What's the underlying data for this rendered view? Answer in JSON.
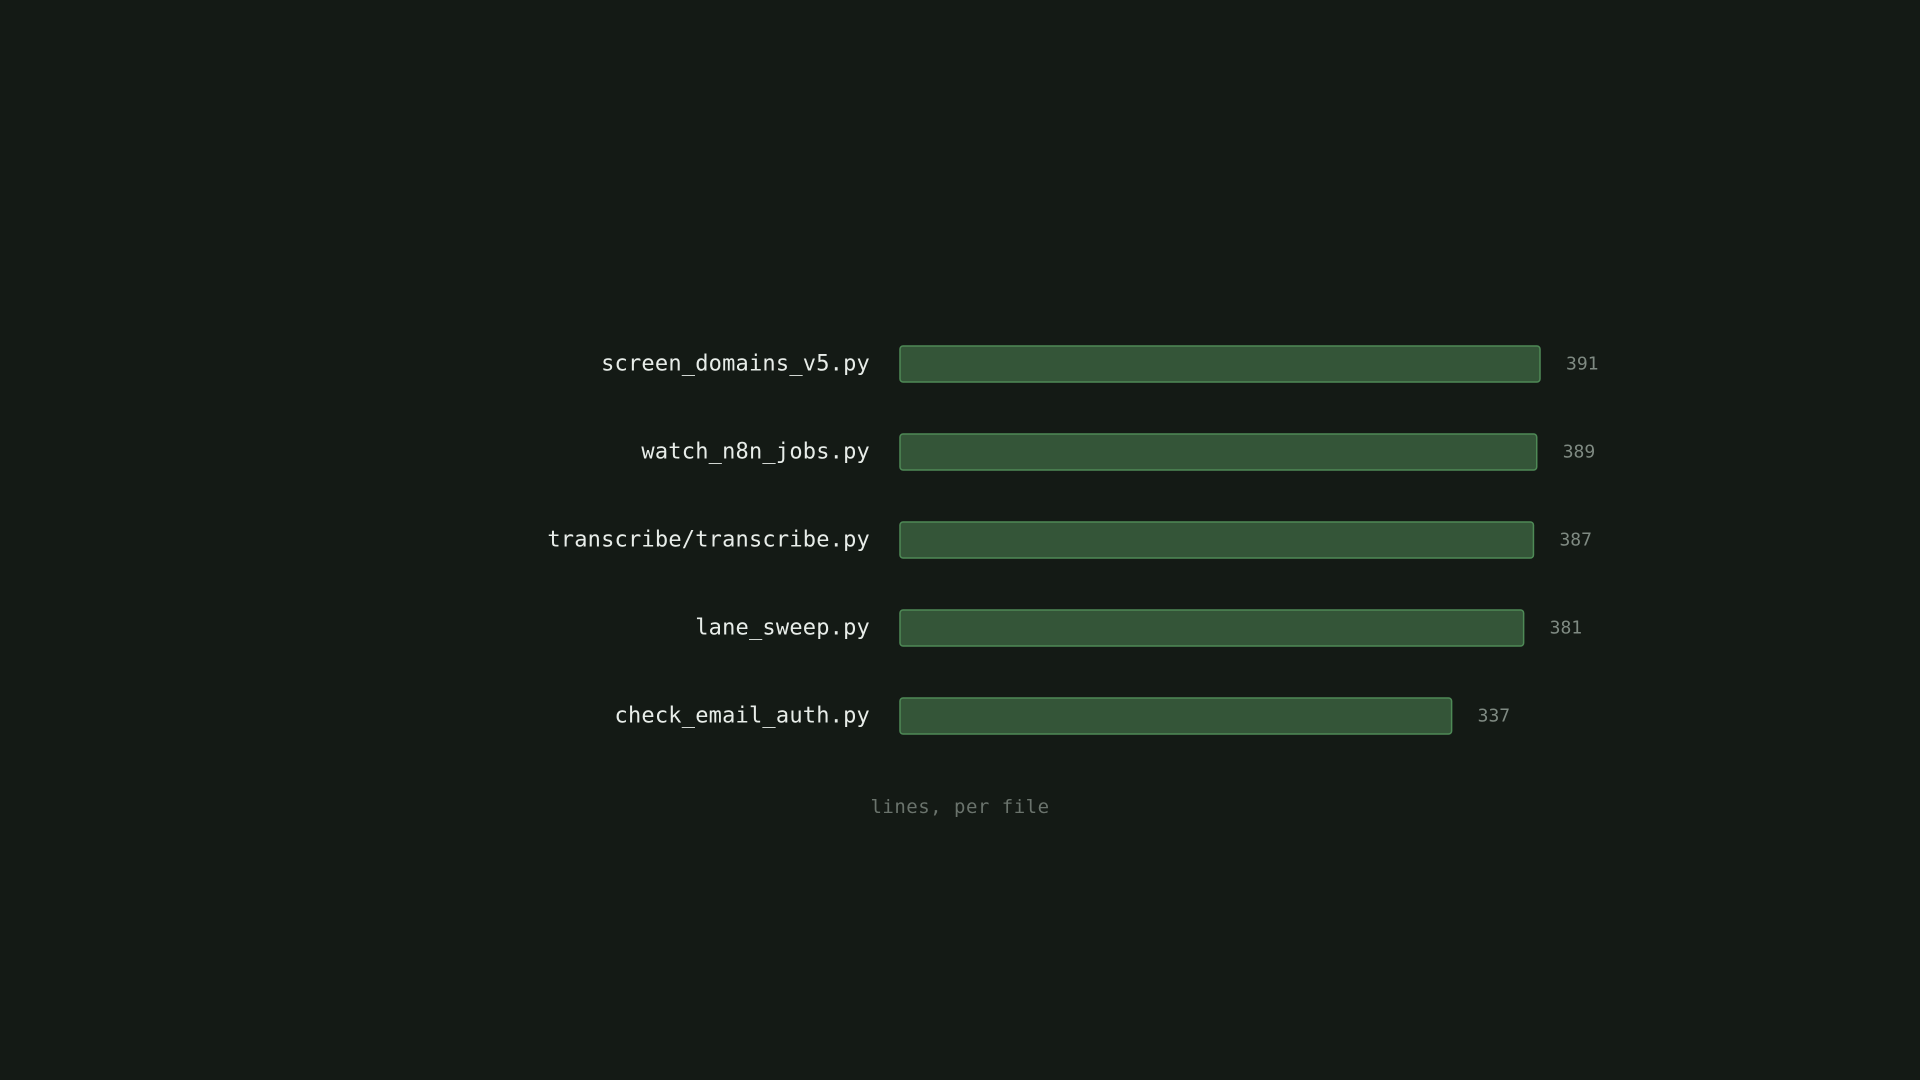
{
  "colors": {
    "background": "#141a15",
    "bar_fill": "#345538",
    "bar_stroke": "#4e8a56",
    "category_text": "#e8ede9",
    "value_text": "#7f8a82",
    "caption_text": "#6a736c"
  },
  "chart_data": {
    "type": "bar",
    "orientation": "horizontal",
    "categories": [
      "screen_domains_v5.py",
      "watch_n8n_jobs.py",
      "transcribe/transcribe.py",
      "lane_sweep.py",
      "check_email_auth.py"
    ],
    "values": [
      391,
      389,
      387,
      381,
      337
    ],
    "caption": "lines, per file",
    "xlim": [
      0,
      391
    ],
    "grid": false,
    "legend": "none"
  }
}
